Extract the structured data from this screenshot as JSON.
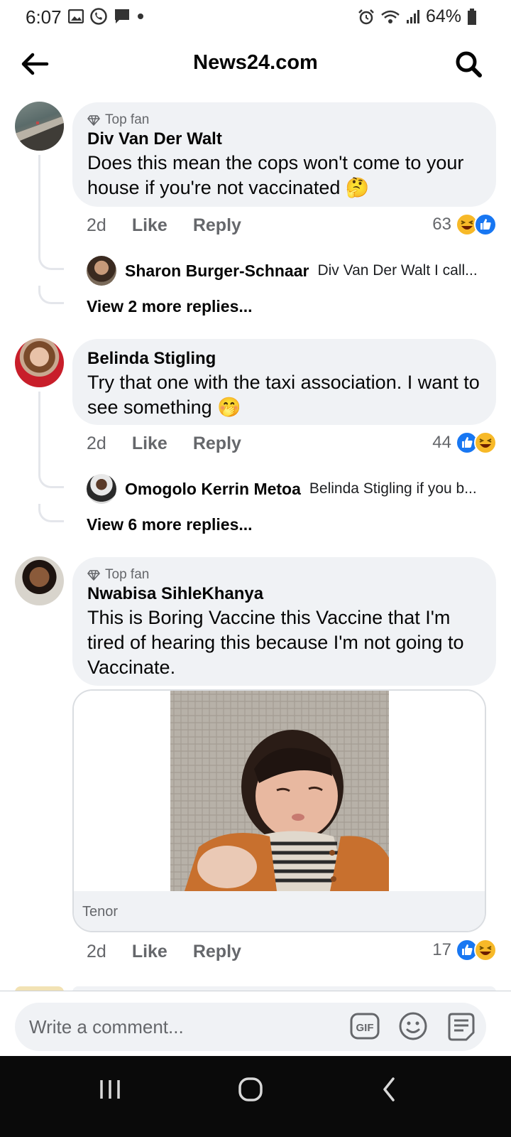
{
  "status_bar": {
    "time": "6:07",
    "battery": "64%"
  },
  "header": {
    "title": "News24.com"
  },
  "comments": [
    {
      "top_fan": "Top fan",
      "author": "Div Van Der Walt",
      "text": "Does this mean the cops won't come to your house if you're not vaccinated 🤔",
      "time": "2d",
      "like_label": "Like",
      "reply_label": "Reply",
      "reaction_count": "63",
      "reply_preview": {
        "author": "Sharon Burger-Schnaar",
        "text": "Div Van Der Walt I call..."
      },
      "more_replies": "View 2 more replies..."
    },
    {
      "author": "Belinda Stigling",
      "text": "Try that one with the taxi association. I want to see something 🤭",
      "time": "2d",
      "like_label": "Like",
      "reply_label": "Reply",
      "reaction_count": "44",
      "reply_preview": {
        "author": "Omogolo Kerrin Metoa",
        "text": "Belinda Stigling if you b..."
      },
      "more_replies": "View 6 more replies..."
    },
    {
      "top_fan": "Top fan",
      "author": "Nwabisa SihleKhanya",
      "text": "This is Boring Vaccine this Vaccine that I'm tired of hearing this because I'm not going to Vaccinate.",
      "gif_source": "Tenor",
      "time": "2d",
      "like_label": "Like",
      "reply_label": "Reply",
      "reaction_count": "17"
    }
  ],
  "composer": {
    "placeholder": "Write a comment..."
  },
  "icons": [
    "back-arrow-icon",
    "search-icon",
    "diamond-icon",
    "like-reaction-icon",
    "haha-reaction-icon",
    "gif-icon",
    "emoji-icon",
    "sticker-icon"
  ],
  "colors": {
    "bubble_bg": "#f0f2f5",
    "like_blue": "#1877f2",
    "haha_yellow": "#f7b928",
    "muted_text": "#65676b"
  }
}
